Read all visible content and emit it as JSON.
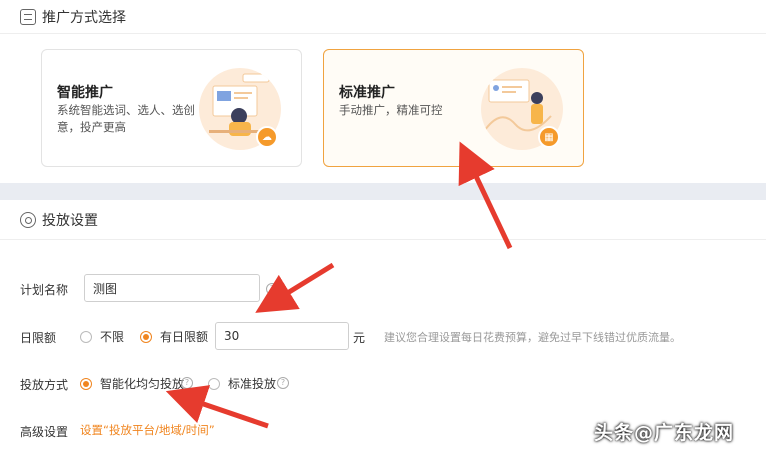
{
  "section1": {
    "title": "推广方式选择"
  },
  "cards": [
    {
      "title": "智能推广",
      "desc": "系统智能选词、选人、选创意，投产更高"
    },
    {
      "title": "标准推广",
      "desc": "手动推广，精准可控"
    }
  ],
  "section2": {
    "title": "投放设置"
  },
  "form": {
    "plan_name": {
      "label": "计划名称",
      "value": "测图"
    },
    "daily_limit": {
      "label": "日限额",
      "option_unlimited": "不限",
      "option_limited": "有日限额",
      "value": "30",
      "unit": "元",
      "hint": "建议您合理设置每日花费预算，避免过早下线错过优质流量。"
    },
    "delivery": {
      "label": "投放方式",
      "option_smart": "智能化均匀投放",
      "option_standard": "标准投放"
    },
    "advanced": {
      "label": "高级设置",
      "link": "设置“投放平台/地域/时间”"
    }
  },
  "watermark": "头条@广东龙网",
  "colors": {
    "accent": "#f0851f",
    "arrow": "#e63b2e",
    "band": "#e9ecf2"
  }
}
